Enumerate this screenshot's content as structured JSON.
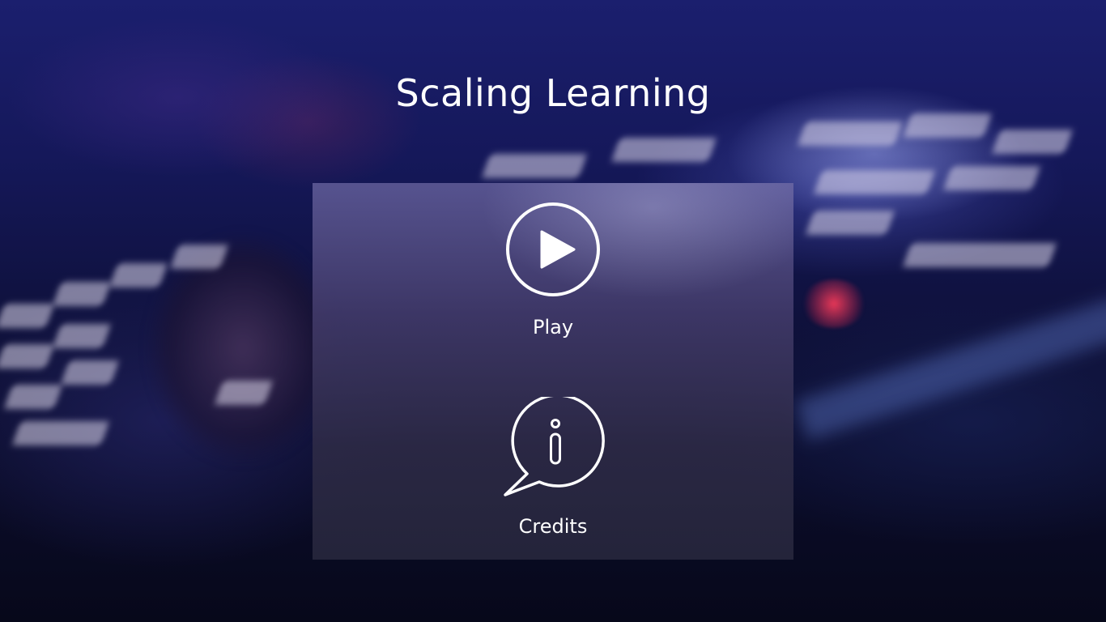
{
  "title": "Scaling Learning",
  "menu": {
    "play": {
      "label": "Play",
      "icon": "play-icon"
    },
    "credits": {
      "label": "Credits",
      "icon": "info-bubble-icon"
    }
  },
  "colors": {
    "text": "#ffffff",
    "background_dark": "#0a0c22",
    "background_blue": "#1b1f6e",
    "panel": "#46406e"
  }
}
